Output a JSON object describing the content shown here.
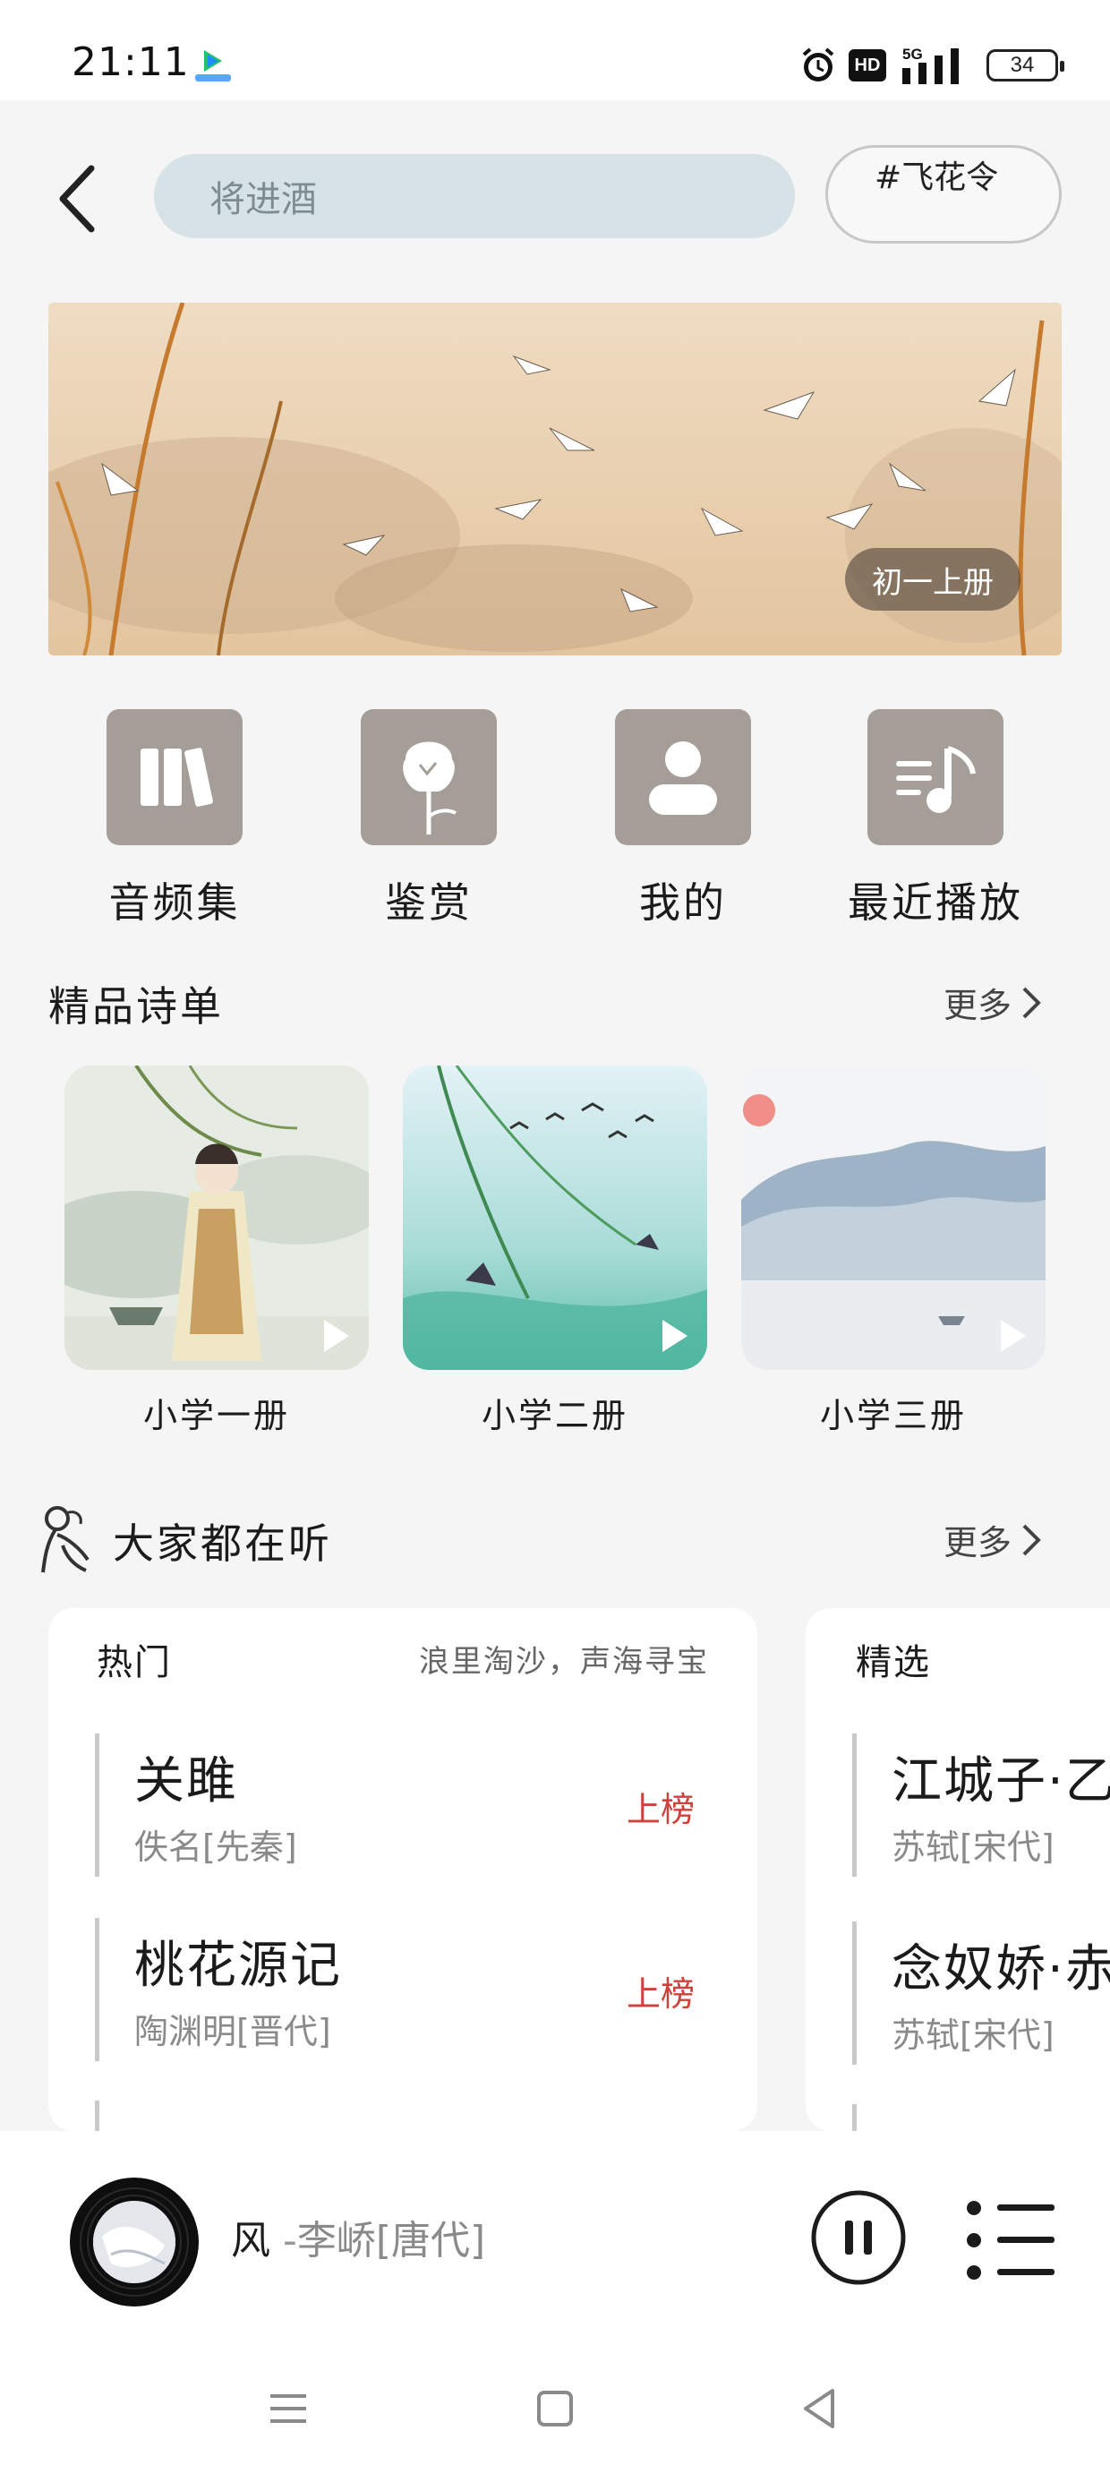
{
  "status_bar": {
    "time": "21:11",
    "hd": "HD",
    "network": "5G",
    "battery": "34",
    "icons": [
      "alarm-icon",
      "signal-icon",
      "battery-icon"
    ]
  },
  "header": {
    "search_value": "将进酒",
    "tag_label": "#飞花令",
    "back_icon": "chevron-left-icon"
  },
  "banner": {
    "badge": "初一上册"
  },
  "quick_entries": [
    {
      "label": "音频集",
      "icon": "books-icon"
    },
    {
      "label": "鉴赏",
      "icon": "flower-icon"
    },
    {
      "label": "我的",
      "icon": "person-icon"
    },
    {
      "label": "最近播放",
      "icon": "music-list-icon"
    }
  ],
  "featured": {
    "title": "精品诗单",
    "more": "更多",
    "items": [
      {
        "label": "小学一册"
      },
      {
        "label": "小学二册"
      },
      {
        "label": "小学三册"
      }
    ]
  },
  "listening": {
    "title": "大家都在听",
    "more": "更多",
    "cards": [
      {
        "title": "热门",
        "subtitle": "浪里淘沙，声海寻宝",
        "poems": [
          {
            "title": "关雎",
            "author": "佚名[先秦]",
            "rank": "上榜"
          },
          {
            "title": "桃花源记",
            "author": "陶渊明[晋代]",
            "rank": "上榜"
          }
        ]
      },
      {
        "title": "精选",
        "poems": [
          {
            "title": "江城子·乙",
            "author": "苏轼[宋代]"
          },
          {
            "title": "念奴娇·赤",
            "author": "苏轼[宋代]"
          }
        ]
      }
    ]
  },
  "player": {
    "title": "风",
    "separator": "-",
    "author": "李峤[唐代]"
  },
  "colors": {
    "accent_rank": "#d0413c",
    "icon_tile": "#a49d98",
    "search_bg": "#d6e2e6"
  }
}
